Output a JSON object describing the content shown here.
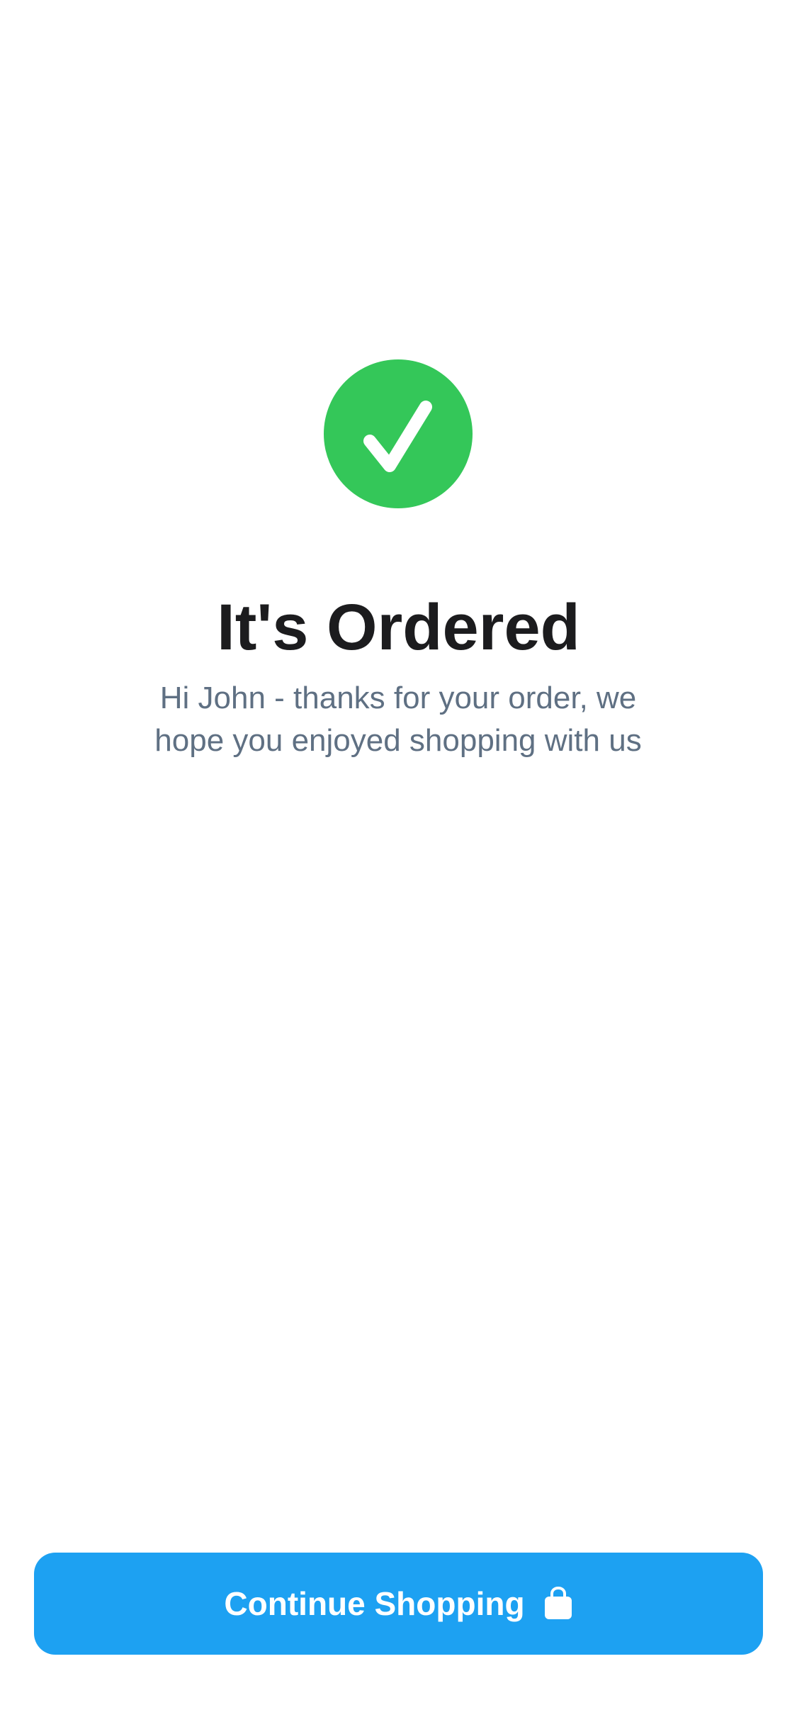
{
  "confirmation": {
    "title": "It's Ordered",
    "message": "Hi John - thanks for your order, we hope you enjoyed shopping with us",
    "icon": "checkmark-circle-icon"
  },
  "actions": {
    "continue_label": "Continue Shopping",
    "continue_icon": "shopping-bag-icon"
  },
  "colors": {
    "success": "#34c759",
    "primary": "#1da1f2",
    "title": "#1c1c1e",
    "message": "#5f7083",
    "background": "#ffffff"
  }
}
